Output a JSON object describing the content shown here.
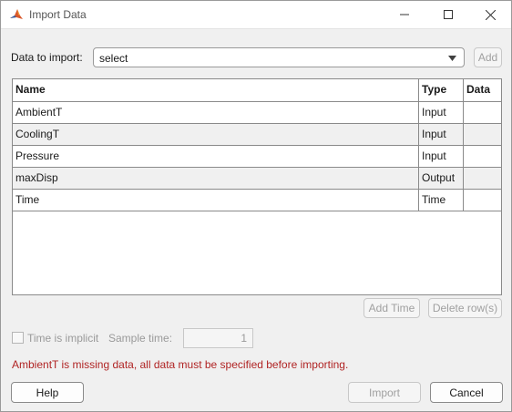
{
  "window": {
    "title": "Import Data"
  },
  "import_row": {
    "label": "Data to import:",
    "selected": "select",
    "add_label": "Add"
  },
  "table": {
    "columns": [
      "Name",
      "Type",
      "Data"
    ],
    "rows": [
      {
        "name": "AmbientT",
        "type": "Input",
        "data": ""
      },
      {
        "name": "CoolingT",
        "type": "Input",
        "data": ""
      },
      {
        "name": "Pressure",
        "type": "Input",
        "data": ""
      },
      {
        "name": "maxDisp",
        "type": "Output",
        "data": ""
      },
      {
        "name": "Time",
        "type": "Time",
        "data": ""
      }
    ]
  },
  "table_actions": {
    "add_time_label": "Add Time",
    "delete_rows_label": "Delete row(s)"
  },
  "time_options": {
    "implicit_label": "Time is implicit",
    "implicit_checked": false,
    "sample_label": "Sample time:",
    "sample_value": "1"
  },
  "error_message": "AmbientT is missing data, all data must be specified before importing.",
  "footer": {
    "help_label": "Help",
    "import_label": "Import",
    "cancel_label": "Cancel"
  },
  "colors": {
    "error": "#b02323",
    "matlab_icon_orange": "#d9582b",
    "matlab_icon_blue": "#2f5fa8"
  }
}
